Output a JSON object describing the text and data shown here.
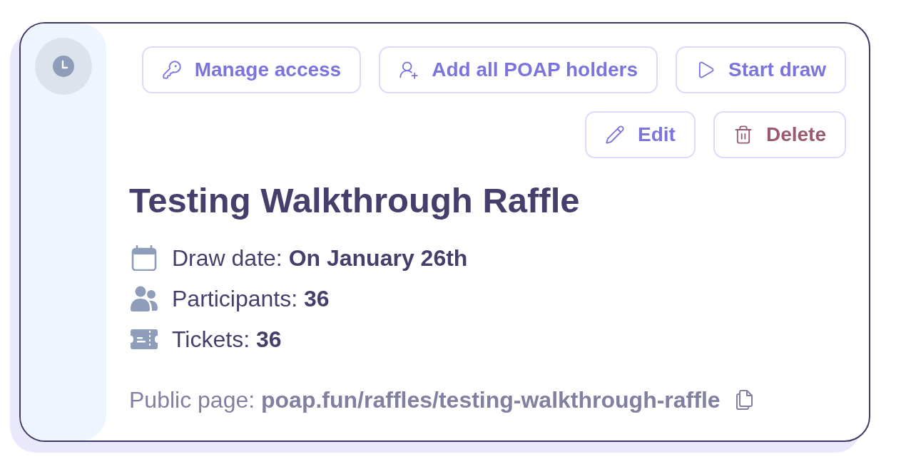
{
  "action_rows": [
    [
      {
        "label": "Manage access",
        "kind": "default"
      },
      {
        "label": "Add all POAP holders",
        "kind": "default"
      },
      {
        "label": "Start draw",
        "kind": "default"
      }
    ],
    [
      {
        "label": "Edit",
        "kind": "default"
      },
      {
        "label": "Delete",
        "kind": "danger"
      }
    ]
  ],
  "raffle": {
    "title": "Testing Walkthrough Raffle",
    "details": [
      {
        "label": "Draw date:",
        "value": "On January 26th"
      },
      {
        "label": "Participants:",
        "value": "36"
      },
      {
        "label": "Tickets:",
        "value": "36"
      }
    ]
  },
  "public_page": {
    "label": "Public page:",
    "url": "poap.fun/raffles/testing-walkthrough-raffle"
  }
}
